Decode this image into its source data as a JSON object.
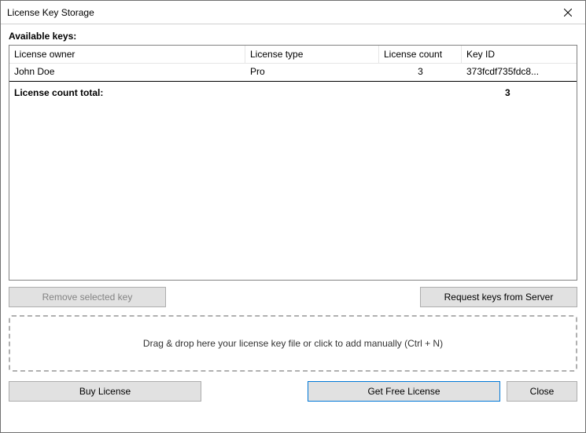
{
  "window": {
    "title": "License Key Storage"
  },
  "section": {
    "available_label": "Available keys:"
  },
  "table": {
    "headers": {
      "owner": "License owner",
      "type": "License type",
      "count": "License count",
      "keyid": "Key ID"
    },
    "rows": [
      {
        "owner": "John Doe",
        "type": "Pro",
        "count": "3",
        "keyid": "373fcdf735fdc8..."
      }
    ],
    "total_label": "License count total:",
    "total_value": "3"
  },
  "buttons": {
    "remove": "Remove selected key",
    "request": "Request keys from Server",
    "buy": "Buy License",
    "free": "Get Free License",
    "close": "Close"
  },
  "dropzone": {
    "text": "Drag & drop here your license key file or click to add manually (Ctrl + N)"
  }
}
